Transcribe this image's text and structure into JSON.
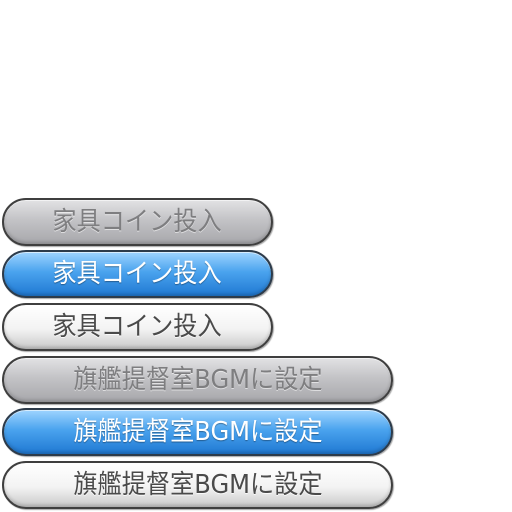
{
  "buttons": {
    "furniture_coin": {
      "label": "家具コイン投入",
      "states": [
        "disabled",
        "hover",
        "normal"
      ]
    },
    "set_bgm": {
      "label": "旗艦提督室BGMに設定",
      "states": [
        "disabled",
        "hover",
        "normal"
      ]
    }
  },
  "colors": {
    "disabled_fill": "#c3c3c6",
    "disabled_text": "#7e7e80",
    "hover_fill": "#4aa3ee",
    "hover_text": "#ffffff",
    "normal_fill": "#f3f3f3",
    "normal_text": "#4a4a4a",
    "border": "#3f3f3f"
  }
}
